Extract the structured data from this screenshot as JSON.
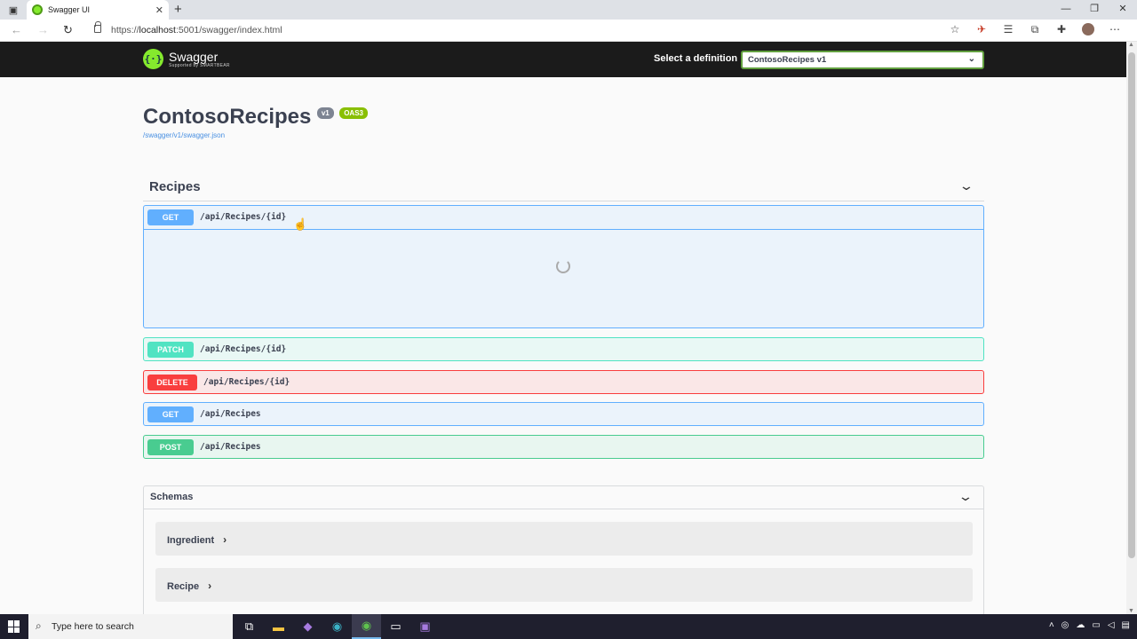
{
  "browser": {
    "tab_title": "Swagger UI",
    "tab_close": "✕",
    "new_tab": "+",
    "url_prefix": "https://",
    "url_host": "localhost",
    "url_rest": ":5001/swagger/index.html",
    "window_controls": [
      "—",
      "❐",
      "✕"
    ]
  },
  "topbar": {
    "logo_name": "Swagger",
    "logo_sub": "Supported by SMARTBEAR",
    "definition_label": "Select a definition",
    "definition_value": "ContosoRecipes v1"
  },
  "info": {
    "title": "ContosoRecipes",
    "version_badge": "v1",
    "oas_badge": "OAS3",
    "spec_link": "/swagger/v1/swagger.json"
  },
  "section": {
    "title": "Recipes"
  },
  "operations": [
    {
      "method": "GET",
      "path": "/api/Recipes/{id}"
    },
    {
      "method": "PATCH",
      "path": "/api/Recipes/{id}"
    },
    {
      "method": "DELETE",
      "path": "/api/Recipes/{id}"
    },
    {
      "method": "GET",
      "path": "/api/Recipes"
    },
    {
      "method": "POST",
      "path": "/api/Recipes"
    }
  ],
  "schemas": {
    "title": "Schemas",
    "models": [
      "Ingredient",
      "Recipe"
    ]
  },
  "taskbar": {
    "search_placeholder": "Type here to search"
  }
}
